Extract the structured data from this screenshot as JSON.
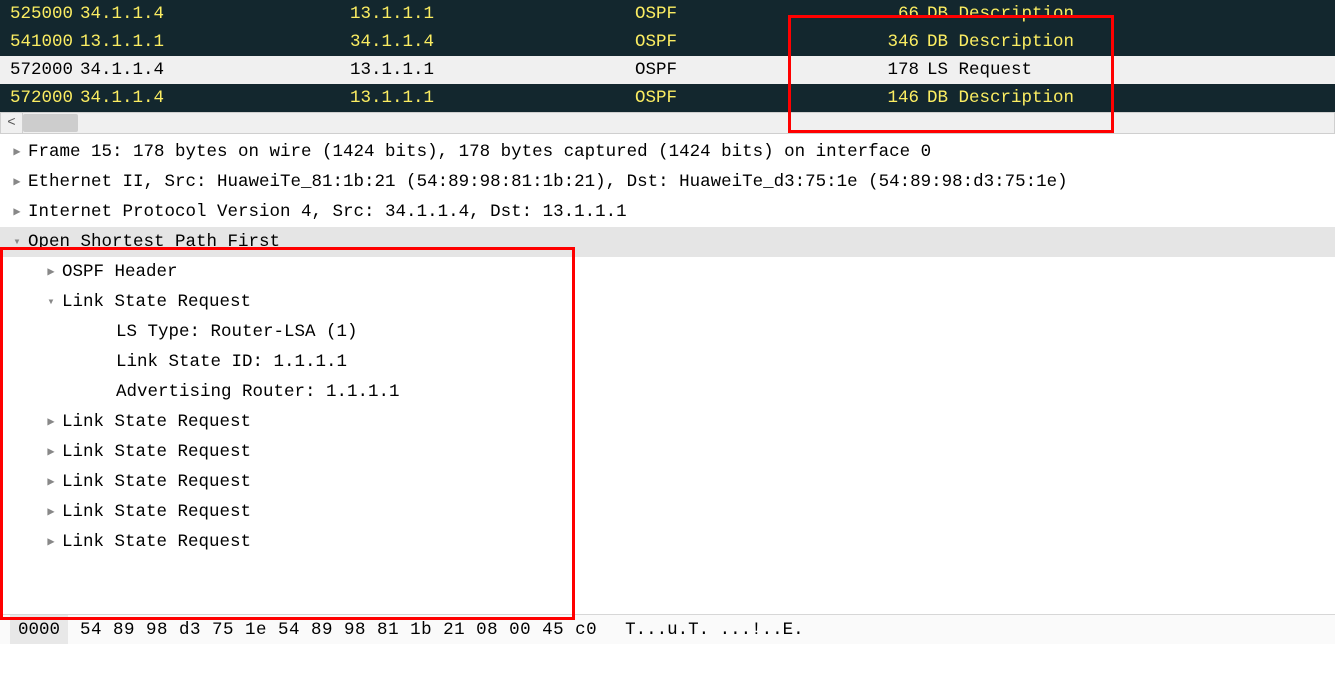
{
  "packets": [
    {
      "no": "525000",
      "src": "34.1.1.4",
      "dst": "13.1.1.1",
      "proto": "OSPF",
      "len": "66",
      "info": "DB Description",
      "style": "dark-row"
    },
    {
      "no": "541000",
      "src": "13.1.1.1",
      "dst": "34.1.1.4",
      "proto": "OSPF",
      "len": "346",
      "info": "DB Description",
      "style": "dark-row"
    },
    {
      "no": "572000",
      "src": "34.1.1.4",
      "dst": "13.1.1.1",
      "proto": "OSPF",
      "len": "178",
      "info": "LS Request",
      "style": "selected-row"
    },
    {
      "no": "572000",
      "src": "34.1.1.4",
      "dst": "13.1.1.1",
      "proto": "OSPF",
      "len": "146",
      "info": "DB Description",
      "style": "dark-row"
    }
  ],
  "details": {
    "frame": "Frame 15: 178 bytes on wire (1424 bits), 178 bytes captured (1424 bits) on interface 0",
    "eth": "Ethernet II, Src: HuaweiTe_81:1b:21 (54:89:98:81:1b:21), Dst: HuaweiTe_d3:75:1e (54:89:98:d3:75:1e)",
    "ip": "Internet Protocol Version 4, Src: 34.1.1.4, Dst: 13.1.1.1",
    "ospf": "Open Shortest Path First",
    "ospf_hdr": "OSPF Header",
    "lsr": "Link State Request",
    "ls_type": "LS Type: Router-LSA (1)",
    "ls_id": "Link State ID: 1.1.1.1",
    "adv_rtr": "Advertising Router: 1.1.1.1",
    "lsr2": "Link State Request",
    "lsr3": "Link State Request",
    "lsr4": "Link State Request",
    "lsr5": "Link State Request",
    "lsr6": "Link State Request"
  },
  "hex": {
    "offset": "0000",
    "bytes": "54 89 98 d3 75 1e 54 89  98 81 1b 21 08 00 45 c0",
    "ascii": "T...u.T. ...!..E."
  },
  "scroll_left_glyph": "<"
}
